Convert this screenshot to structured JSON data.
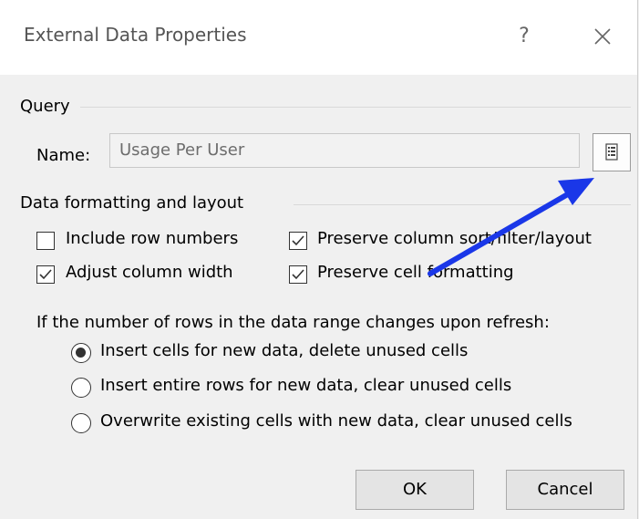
{
  "dialog": {
    "title": "External Data Properties",
    "help_label": "?",
    "close_icon": "close-icon"
  },
  "query": {
    "group_label": "Query",
    "name_label": "Name:",
    "name_value": "Usage Per User",
    "properties_button_icon": "query-properties-icon"
  },
  "formatting": {
    "group_label": "Data formatting and layout",
    "options": {
      "include_row_numbers": {
        "label": "Include row numbers",
        "checked": false
      },
      "adjust_column_width": {
        "label": "Adjust column width",
        "checked": true
      },
      "preserve_sort_filter": {
        "label": "Preserve column sort/filter/layout",
        "checked": true
      },
      "preserve_cell_formatting": {
        "label": "Preserve cell formatting",
        "checked": true
      }
    }
  },
  "refresh": {
    "prompt": "If the number of rows in the data range changes upon refresh:",
    "options": [
      {
        "label": "Insert cells for new data, delete unused cells",
        "selected": true
      },
      {
        "label": "Insert entire rows for new data, clear unused cells",
        "selected": false
      },
      {
        "label": "Overwrite existing cells with new data, clear unused cells",
        "selected": false
      }
    ]
  },
  "buttons": {
    "ok": "OK",
    "cancel": "Cancel"
  },
  "annotation": {
    "arrow_color": "#1a37e8"
  }
}
